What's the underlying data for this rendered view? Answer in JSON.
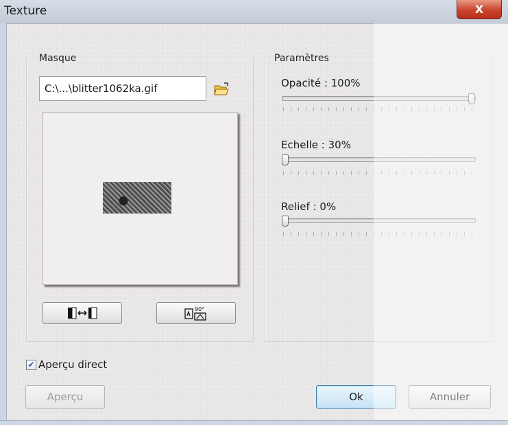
{
  "window": {
    "title": "Texture",
    "close_label": "X"
  },
  "mask_group": {
    "label": "Masque",
    "file_path": "C:\\...\\blitter1062ka.gif"
  },
  "params_group": {
    "label": "Paramètres",
    "sliders": [
      {
        "label": "Opacité : 100%",
        "value_percent": 100
      },
      {
        "label": "Echelle : 30%",
        "value_percent": 30
      },
      {
        "label": "Relief : 0%",
        "value_percent": 0
      }
    ]
  },
  "live_preview": {
    "label": "Aperçu direct",
    "checked": true
  },
  "buttons": {
    "preview": "Aperçu",
    "ok": "Ok",
    "cancel": "Annuler"
  },
  "rotate_icon_text": "90°"
}
